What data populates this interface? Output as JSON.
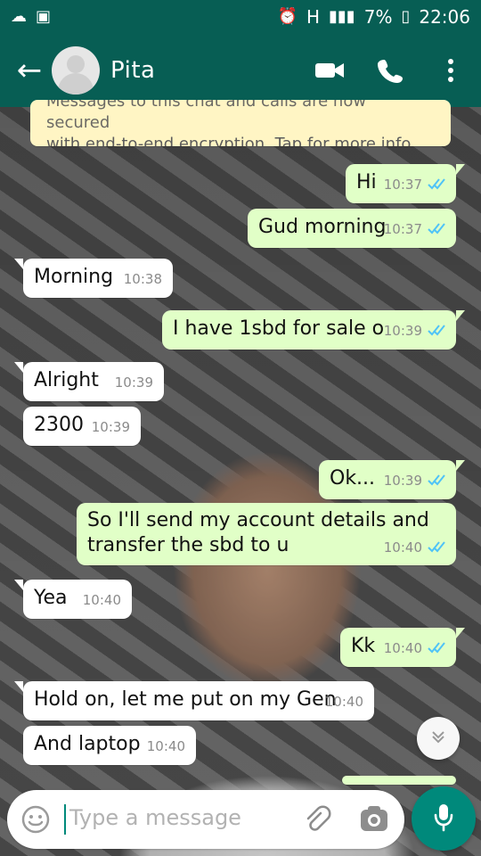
{
  "status_bar": {
    "left_icons": [
      "cloud-icon",
      "image-icon"
    ],
    "alarm_icon": "alarm-icon",
    "network_label": "H",
    "battery_percent": "7%",
    "time": "22:06"
  },
  "app_bar": {
    "contact_name": "Pita",
    "icons": [
      "back-arrow-icon",
      "video-call-icon",
      "phone-icon",
      "more-vert-icon"
    ],
    "brand_color": "#075e54"
  },
  "encryption_notice": {
    "line1": "Messages to this chat and calls are now secured",
    "line2": "with end-to-end encryption. Tap for more info."
  },
  "messages": [
    {
      "direction": "out",
      "text": "Hi",
      "time": "10:37",
      "read_ticks": true
    },
    {
      "direction": "out",
      "text": "Gud morning",
      "time": "10:37",
      "read_ticks": true
    },
    {
      "direction": "in",
      "text": "Morning",
      "time": "10:38"
    },
    {
      "direction": "out",
      "text": "I have 1sbd for sale o",
      "time": "10:39",
      "read_ticks": true
    },
    {
      "direction": "in",
      "text": "Alright",
      "time": "10:39"
    },
    {
      "direction": "in",
      "text": "2300",
      "time": "10:39"
    },
    {
      "direction": "out",
      "text": "Ok...",
      "time": "10:39",
      "read_ticks": true
    },
    {
      "direction": "out",
      "text": "So I'll send my account details and transfer the sbd to u",
      "time": "10:40",
      "read_ticks": true
    },
    {
      "direction": "in",
      "text": "Yea",
      "time": "10:40"
    },
    {
      "direction": "out",
      "text": "Kk",
      "time": "10:40",
      "read_ticks": true
    },
    {
      "direction": "in",
      "text": "Hold on, let me put on my Gen",
      "time": "10:40"
    },
    {
      "direction": "in",
      "text": "And laptop",
      "time": "10:40"
    }
  ],
  "composer": {
    "placeholder": "Type a message",
    "icons": [
      "emoji-icon",
      "attach-icon",
      "camera-icon",
      "mic-icon",
      "scroll-down-icon"
    ]
  },
  "colors": {
    "outgoing_bubble": "#e1ffc7",
    "incoming_bubble": "#ffffff",
    "read_tick": "#4fc3f7",
    "mic_button": "#00897b"
  }
}
